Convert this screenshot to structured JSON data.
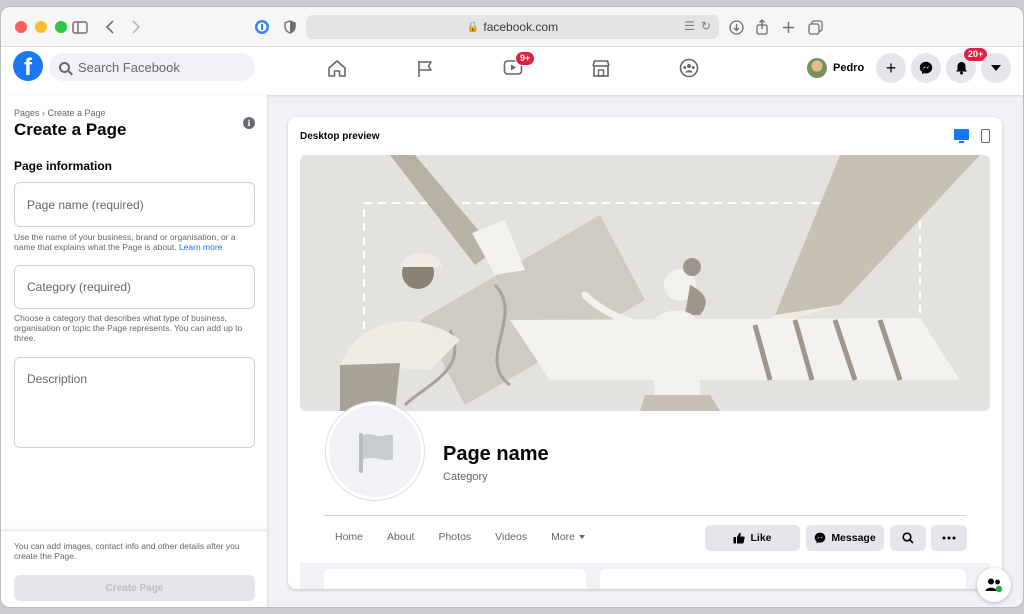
{
  "browser": {
    "url": "facebook.com"
  },
  "nav": {
    "search_placeholder": "Search Facebook",
    "watch_badge": "9+",
    "notifications_badge": "20+",
    "profile_name": "Pedro"
  },
  "left": {
    "breadcrumb": "Pages › Create a Page",
    "title": "Create a Page",
    "section_title": "Page information",
    "page_name_placeholder": "Page name (required)",
    "page_name_hint": "Use the name of your business, brand or organisation, or a name that explains what the Page is about.",
    "learn_more": "Learn more",
    "category_placeholder": "Category (required)",
    "category_hint": "Choose a category that describes what type of business, organisation or topic the Page represents. You can add up to three.",
    "description_placeholder": "Description",
    "bottom_note": "You can add images, contact info and other details after you create the Page.",
    "create_button": "Create Page"
  },
  "preview": {
    "title": "Desktop preview",
    "page_name": "Page name",
    "category": "Category",
    "tabs": [
      "Home",
      "About",
      "Photos",
      "Videos",
      "More"
    ],
    "like_button": "Like",
    "message_button": "Message"
  },
  "colors": {
    "brand": "#1877f2",
    "badge": "#e41e3f",
    "cover_bg": "#e4e2de"
  }
}
